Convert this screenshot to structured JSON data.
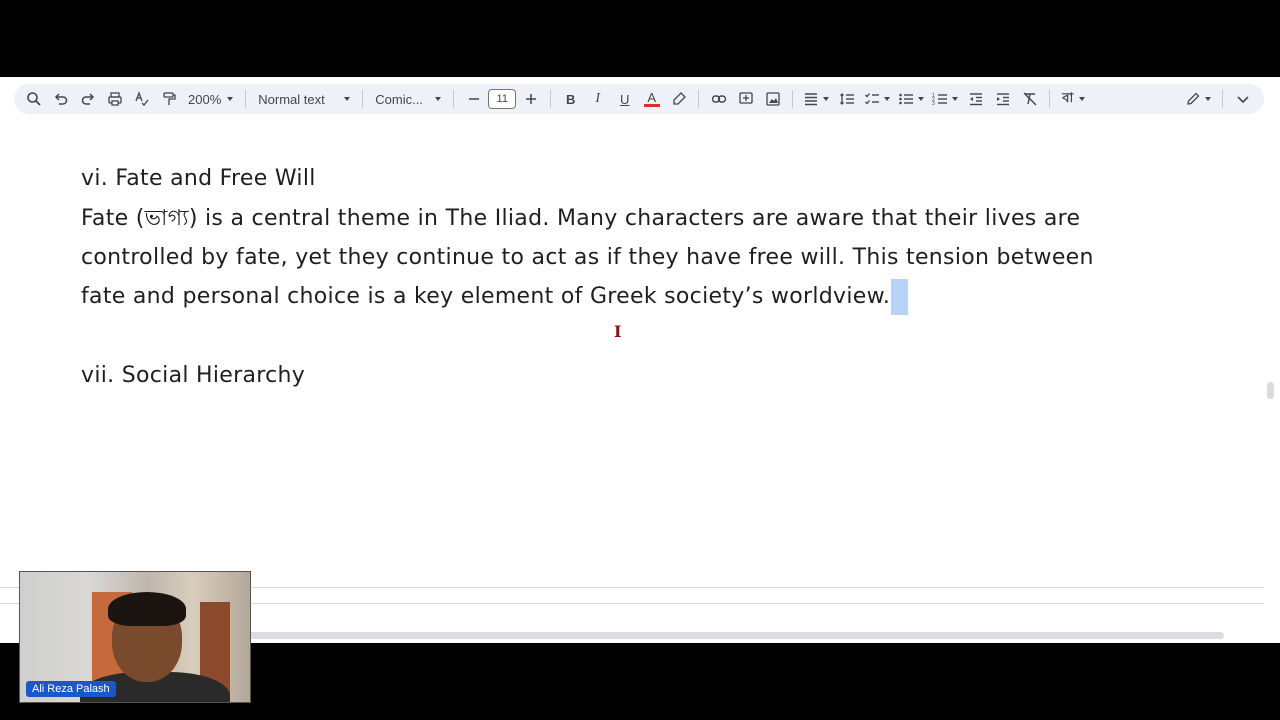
{
  "toolbar": {
    "zoom": "200%",
    "paragraph_style": "Normal text",
    "font": "Comic...",
    "font_size": "11",
    "bold": "B",
    "italic": "I",
    "underline": "U",
    "text_color": "A",
    "input_tool": "বা"
  },
  "document": {
    "heading_fate": "vi. Fate and Free Will",
    "para_line1": "Fate (ভাগ্য) is a central theme in The Iliad. Many characters are aware that their lives are",
    "para_line2": "controlled by fate, yet they continue to act as if they have free will. This tension between",
    "para_line3": "fate and personal choice is a key element of Greek society’s worldview.",
    "heading_social": "vii. Social Hierarchy"
  },
  "webcam": {
    "name": "Ali Reza Palash"
  },
  "colors": {
    "selection": "#b9d2f7",
    "toolbar_bg": "#eef2f8",
    "text_color_underline": "#d93025",
    "name_badge": "#1a57c9"
  }
}
